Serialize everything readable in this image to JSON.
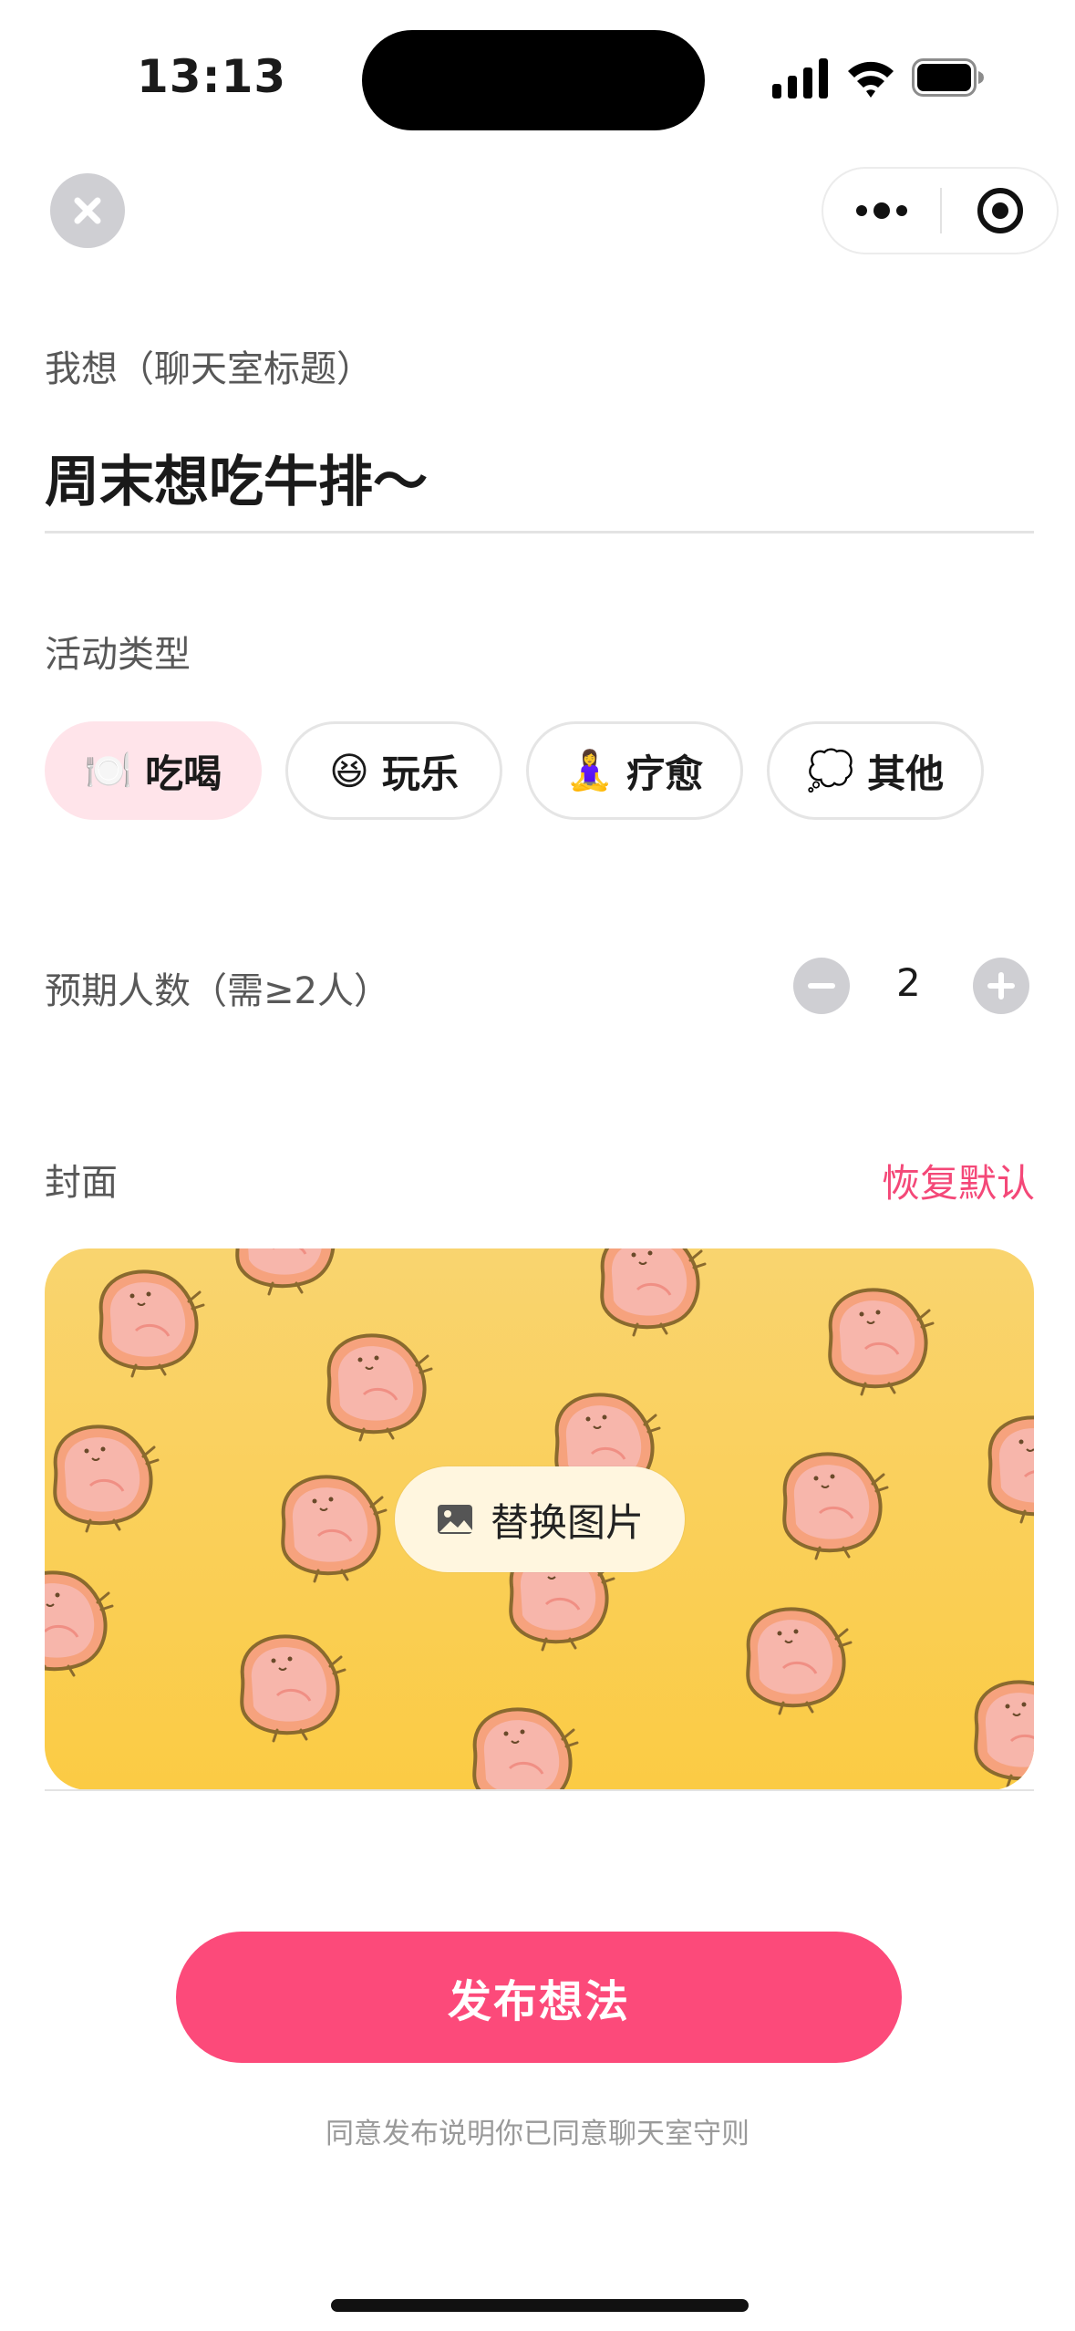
{
  "status_bar": {
    "time": "13:13"
  },
  "form": {
    "title_label": "我想（聊天室标题）",
    "title_value": "周末想吃牛排～",
    "type_label": "活动类型",
    "types": [
      {
        "emoji": "🍽️",
        "label": "吃喝",
        "selected": true
      },
      {
        "emoji": "😆",
        "label": "玩乐",
        "selected": false
      },
      {
        "emoji": "🧘‍♀️",
        "label": "疗愈",
        "selected": false
      },
      {
        "emoji": "💭",
        "label": "其他",
        "selected": false
      }
    ],
    "count_label": "预期人数（需≥2人）",
    "count_value": "2",
    "cover_label": "封面",
    "reset_label": "恢复默认",
    "replace_label": "替换图片"
  },
  "publish_label": "发布想法",
  "agreement": "同意发布说明你已同意聊天室守则",
  "colors": {
    "accent": "#fc4a7a",
    "chip_active_bg": "#ffe4ea",
    "cover_top": "#f9d46f",
    "cover_bottom": "#fbcb44"
  },
  "icons": [
    "close-icon",
    "more-icon",
    "target-icon",
    "minus-icon",
    "plus-icon",
    "image-icon"
  ]
}
